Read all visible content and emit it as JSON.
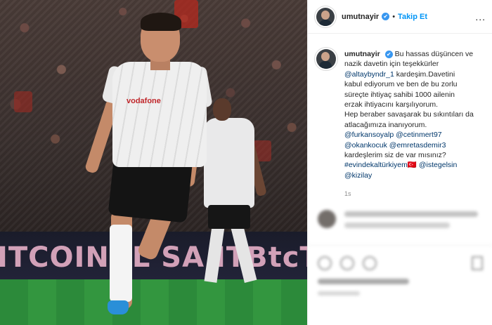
{
  "post": {
    "username": "umutnayir",
    "verified_symbol": "✔",
    "separator": "•",
    "follow_label": "Takip Et",
    "more_label": "...",
    "caption": {
      "author": "umutnayir",
      "text_1": "Bu hassas düşüncen ve",
      "text_2": "nazik davetin için teşekkürler",
      "mention_1": "@altaybyndr_1",
      "text_3": " kardeşim.Davetini",
      "text_4": "kabul ediyorum ve ben de bu zorlu",
      "text_5": "süreçte ihtiyaç sahibi 1000 ailenin",
      "text_6": "erzak ihtiyacını karşılıyorum.",
      "text_7": "Hep beraber savaşarak bu sıkıntıları da",
      "text_8": "atlacağımıza inanıyorum.",
      "mention_2": "@furkansoyalp",
      "mention_3": "@cetinmert97",
      "mention_4": "@okankocuk",
      "mention_5": "@emretasdemir3",
      "text_9": "kardeşlerim siz de var mısınız?",
      "hashtag_1": "#evindekaltürkiyem",
      "flag": "🇹🇷",
      "mention_6": "@istegelsin",
      "mention_7": "@kizilay"
    },
    "time": "1s"
  },
  "photo": {
    "ad_board_text": "ITCOINAL SA  ITBtcT",
    "shirt_sponsor": "vodafone"
  },
  "colors": {
    "link": "#00376b",
    "follow": "#0095f6",
    "verified": "#3897f0"
  }
}
